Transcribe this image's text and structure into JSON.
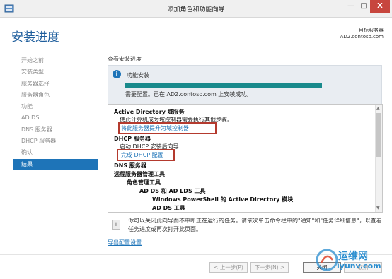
{
  "window": {
    "title": "添加角色和功能向导",
    "min_glyph": "—",
    "max_glyph": "□",
    "close_glyph": "X"
  },
  "page": {
    "title": "安装进度",
    "destination_label": "目标服务器",
    "destination_server": "AD2.contoso.com"
  },
  "nav": {
    "items": [
      {
        "label": "开始之前",
        "active": false
      },
      {
        "label": "安装类型",
        "active": false
      },
      {
        "label": "服务器选择",
        "active": false
      },
      {
        "label": "服务器角色",
        "active": false
      },
      {
        "label": "功能",
        "active": false
      },
      {
        "label": "AD DS",
        "active": false
      },
      {
        "label": "DNS 服务器",
        "active": false
      },
      {
        "label": "DHCP 服务器",
        "active": false
      },
      {
        "label": "确认",
        "active": false
      },
      {
        "label": "结果",
        "active": true
      }
    ]
  },
  "main": {
    "section_title": "查看安装进度",
    "info_glyph": "i",
    "feature_install_label": "功能安装",
    "progress_percent": 100,
    "status_message": "需要配置。已在 AD2.contoso.com 上安装成功。",
    "results": {
      "ad_title": "Active Directory 域服务",
      "ad_desc": "使此计算机成为域控制器需要执行其他步骤。",
      "ad_link": "将此服务器提升为域控制器",
      "dhcp_title": "DHCP 服务器",
      "dhcp_desc": "启动 DHCP 安装后向导",
      "dhcp_link": "完成 DHCP 配置",
      "dns_title": "DNS 服务器",
      "rsat_title": "远程服务器管理工具",
      "role_tools": "角色管理工具",
      "adds_tools": "AD DS 和 AD LDS 工具",
      "ps_module": "Windows PowerShell 的 Active Directory 模块",
      "adds_tools_cut": "AD DS 工具"
    },
    "note_glyph": "i",
    "note_text": "你可以关闭此向导而不中断正在运行的任务。请依次单击命令栏中的\"通知\"和\"任务详细信息\"，以查看任务进度或再次打开此页面。",
    "export_link": "导出配置设置"
  },
  "buttons": {
    "prev": "< 上一步(P)",
    "next": "下一步(N) >",
    "close": "关闭",
    "cancel": "取消"
  },
  "watermark": {
    "text1": "运维网",
    "text2": "iyunv.com"
  },
  "colors": {
    "accent": "#1e74b8",
    "title_blue": "#1e5d9c",
    "progress": "#198a8c",
    "highlight_box": "#b43a2e",
    "close_red": "#c7463e"
  }
}
